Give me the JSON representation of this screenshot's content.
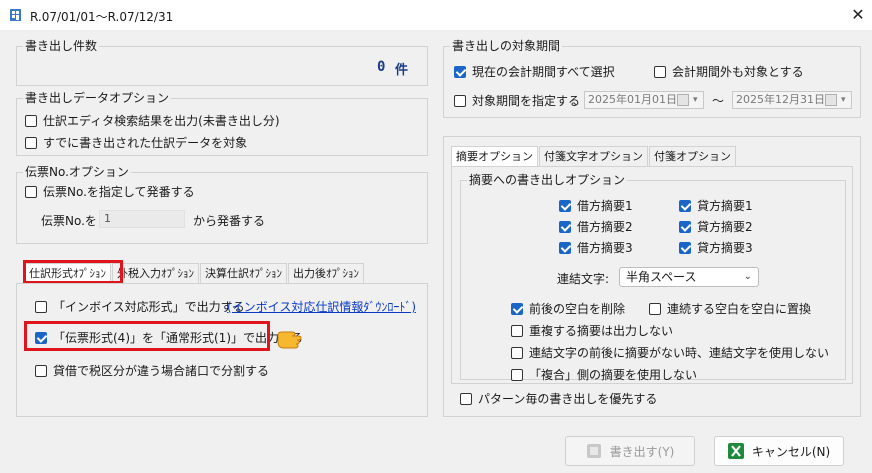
{
  "window": {
    "title": "R.07/01/01～R.07/12/31"
  },
  "export_count": {
    "legend": "書き出し件数",
    "value": "0",
    "unit": "件"
  },
  "data_options": {
    "legend": "書き出しデータオプション",
    "items": [
      {
        "label": "仕訳エディタ検索結果を出力(未書き出し分)",
        "checked": false
      },
      {
        "label": "すでに書き出された仕訳データを対象",
        "checked": false
      }
    ]
  },
  "slip_options": {
    "legend": "伝票No.オプション",
    "checkbox_label": "伝票No.を指定して発番する",
    "field_label": "伝票No.を",
    "field_value": "1",
    "field_suffix": "から発番する"
  },
  "left_tabs": [
    "仕訳形式ｵﾌﾟｼｮﾝ",
    "外税入力ｵﾌﾟｼｮﾝ",
    "決算仕訳ｵﾌﾟｼｮﾝ",
    "出力後ｵﾌﾟｼｮﾝ"
  ],
  "journal_format": {
    "invoice_label": "「インボイス対応形式」で出力する",
    "invoice_link": "(インボイス対応仕訳情報ﾀﾞｳﾝﾛｰﾄﾞ)",
    "slip_format_label": "「伝票形式(4)」を「通常形式(1)」で出力する",
    "split_label": "貸借で税区分が違う場合諸口で分割する"
  },
  "period": {
    "legend": "書き出しの対象期間",
    "all_label": "現在の会計期間すべて選択",
    "outside_label": "会計期間外も対象とする",
    "specify_label": "対象期間を指定する",
    "date_from": "2025年01月01日",
    "tilde": "～",
    "date_to": "2025年12月31日"
  },
  "right_tabs": [
    "摘要オプション",
    "付箋文字オプション",
    "付箋オプション"
  ],
  "summary_options": {
    "legend": "摘要への書き出しオプション",
    "debit": [
      "借方摘要1",
      "借方摘要2",
      "借方摘要3"
    ],
    "credit": [
      "貸方摘要1",
      "貸方摘要2",
      "貸方摘要3"
    ],
    "join_label": "連結文字:",
    "join_value": "半角スペース",
    "trim_label": "前後の空白を削除",
    "merge_space_label": "連続する空白を空白に置換",
    "dup_label": "重複する摘要は出力しない",
    "no_join_label": "連結文字の前後に摘要がない時、連結文字を使用しない",
    "compound_label": "「複合」側の摘要を使用しない",
    "pattern_label": "パターン毎の書き出しを優先する"
  },
  "buttons": {
    "export": "書き出す(Y)",
    "cancel": "キャンセル(N)"
  },
  "colors": {
    "accent": "#1a66c7",
    "highlight": "#e0141c",
    "link": "#0a3ac8"
  }
}
